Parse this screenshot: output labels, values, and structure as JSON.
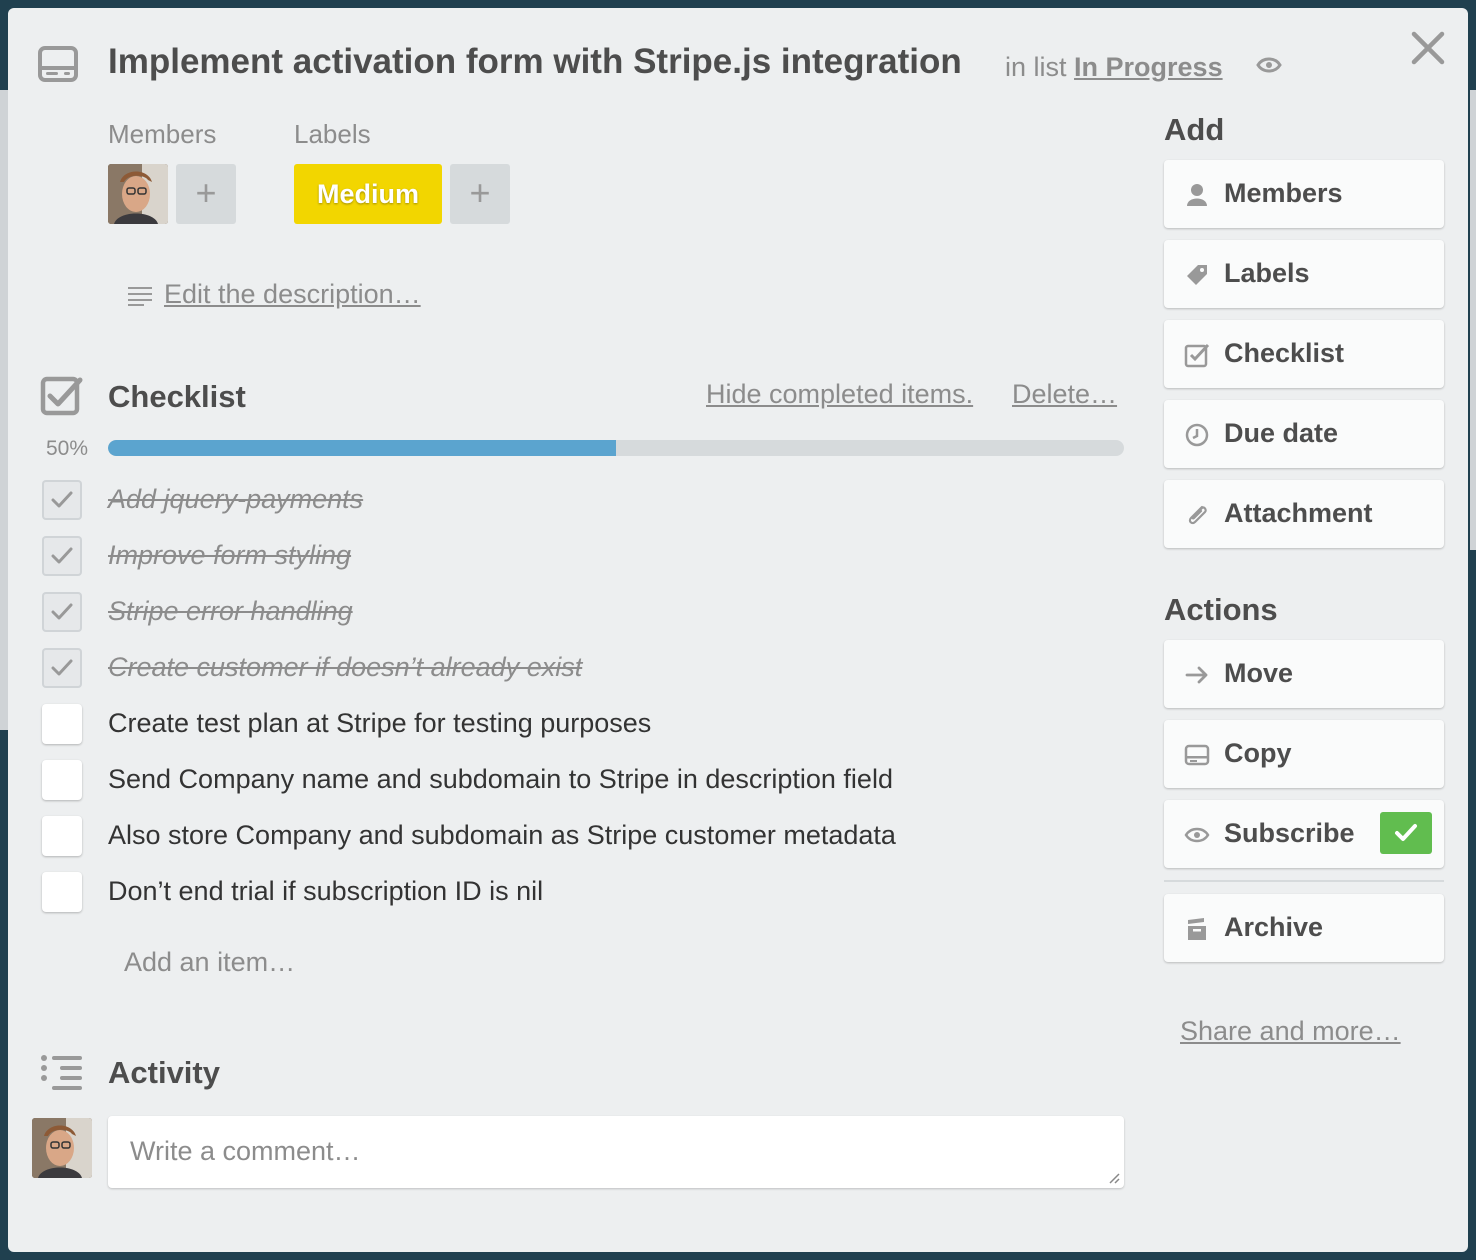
{
  "card": {
    "title": "Implement activation form with Stripe.js integration",
    "in_list_prefix": "in list",
    "list_name": "In Progress"
  },
  "members": {
    "label": "Members",
    "add_symbol": "+"
  },
  "labels": {
    "label": "Labels",
    "chip": "Medium",
    "chip_color": "#f2d600",
    "add_symbol": "+"
  },
  "description": {
    "link": "Edit the description…"
  },
  "checklist": {
    "title": "Checklist",
    "hide_completed": "Hide completed items.",
    "delete": "Delete…",
    "progress_label": "50%",
    "progress": 0.5,
    "progress_color": "#5ba4cf",
    "items": [
      {
        "text": "Add jquery-payments",
        "done": true
      },
      {
        "text": "Improve form styling",
        "done": true
      },
      {
        "text": "Stripe error handling",
        "done": true
      },
      {
        "text": "Create customer if doesn’t already exist",
        "done": true
      },
      {
        "text": "Create test plan at Stripe for testing purposes",
        "done": false
      },
      {
        "text": "Send Company name and subdomain to Stripe in description field",
        "done": false
      },
      {
        "text": "Also store Company and subdomain as Stripe customer metadata",
        "done": false
      },
      {
        "text": "Don’t end trial if subscription ID is nil",
        "done": false
      }
    ],
    "add_item": "Add an item…"
  },
  "activity": {
    "title": "Activity",
    "comment_placeholder": "Write a comment…"
  },
  "sidebar": {
    "add_heading": "Add",
    "add_buttons": [
      {
        "label": "Members",
        "icon": "person-icon"
      },
      {
        "label": "Labels",
        "icon": "tag-icon"
      },
      {
        "label": "Checklist",
        "icon": "checkbox-icon"
      },
      {
        "label": "Due date",
        "icon": "clock-icon"
      },
      {
        "label": "Attachment",
        "icon": "paperclip-icon"
      }
    ],
    "actions_heading": "Actions",
    "action_buttons": [
      {
        "label": "Move",
        "icon": "arrow-right-icon"
      },
      {
        "label": "Copy",
        "icon": "card-icon"
      },
      {
        "label": "Subscribe",
        "icon": "eye-icon",
        "subscribed": true
      }
    ],
    "archive": {
      "label": "Archive",
      "icon": "archive-icon"
    },
    "share": "Share and more…",
    "subscribe_check_color": "#61bd4f"
  }
}
